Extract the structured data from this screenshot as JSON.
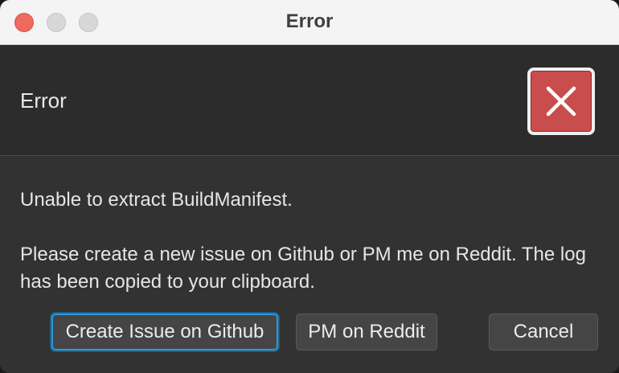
{
  "window": {
    "title": "Error",
    "controls": [
      "close-button",
      "minimize-button",
      "zoom-button"
    ]
  },
  "header": {
    "title": "Error",
    "icon": "error-x-icon",
    "icon_color": "#c94d4c"
  },
  "message": {
    "line1": "Unable to extract BuildManifest.",
    "line2": "Please create a new issue on Github or PM me on Reddit. The log has been copied to your clipboard."
  },
  "buttons": {
    "create_issue": "Create Issue on Github",
    "pm_reddit": "PM on Reddit",
    "cancel": "Cancel"
  },
  "colors": {
    "focus_ring": "#2e9ad8",
    "background": "#323232"
  }
}
